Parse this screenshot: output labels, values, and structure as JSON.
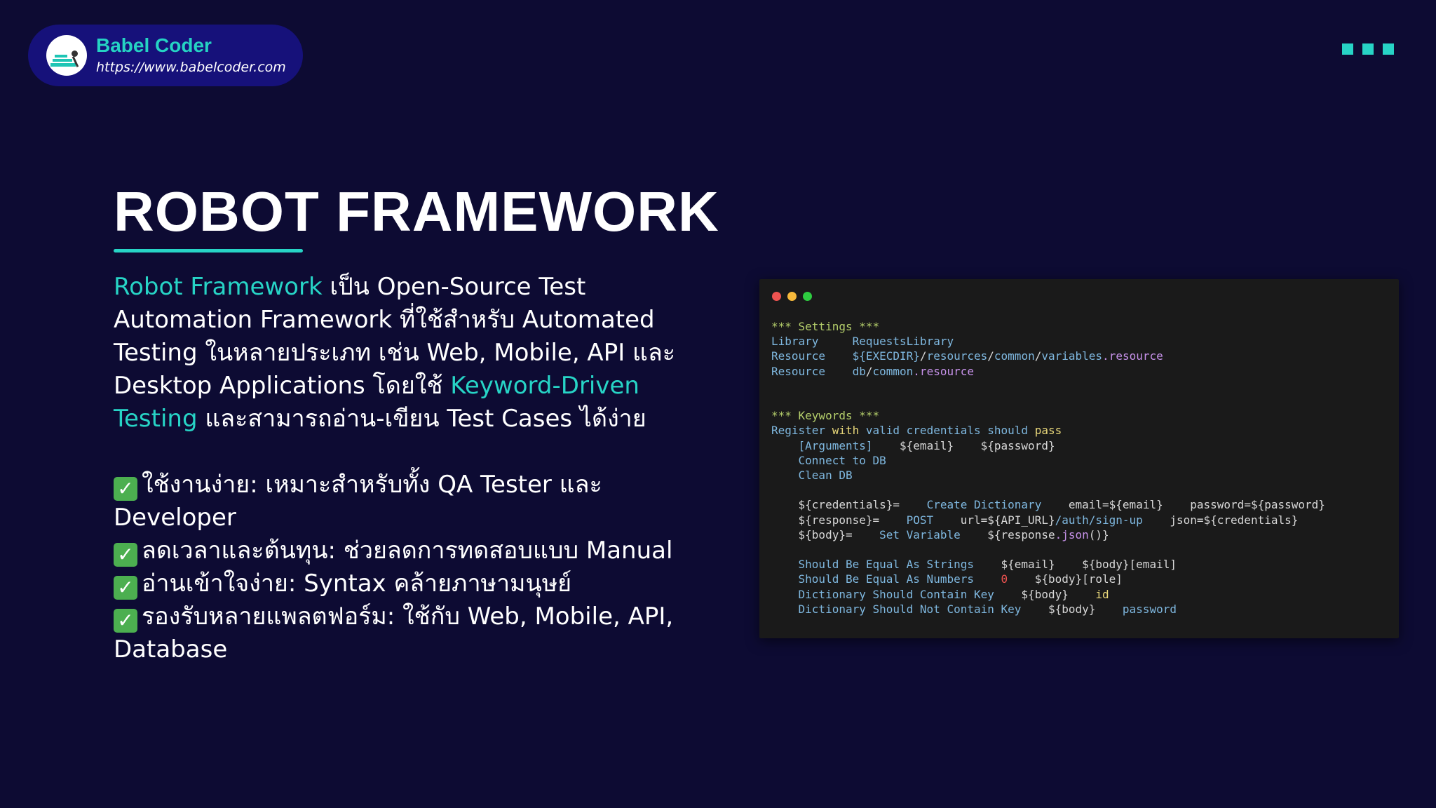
{
  "brand": {
    "name": "Babel Coder",
    "url": "https://www.babelcoder.com",
    "logo_icon": "babel-coder-logo"
  },
  "colors": {
    "background": "#0d0b33",
    "accent": "#27d4c6",
    "brand_pill": "#16117a",
    "code_bg": "#1a1a1a"
  },
  "title": "ROBOT FRAMEWORK",
  "description": {
    "highlight1": "Robot Framework",
    "part1": " เป็น Open-Source Test Automation Framework ที่ใช้สำหรับ Automated Testing ในหลายประเภท เช่น Web, Mobile, API และ Desktop Applications โดยใช้ ",
    "highlight2": "Keyword-Driven Testing",
    "part2": " และสามารถอ่าน-เขียน Test Cases ได้ง่าย"
  },
  "features": [
    {
      "icon": "check-mark-icon",
      "text": "ใช้งานง่าย: เหมาะสำหรับทั้ง QA Tester และ Developer"
    },
    {
      "icon": "check-mark-icon",
      "text": "ลดเวลาและต้นทุน: ช่วยลดการทดสอบแบบ Manual"
    },
    {
      "icon": "check-mark-icon",
      "text": "อ่านเข้าใจง่าย: Syntax คล้ายภาษามนุษย์"
    },
    {
      "icon": "check-mark-icon",
      "text": "รองรับหลายแพลตฟอร์ม: ใช้กับ Web, Mobile, API, Database"
    }
  ],
  "code_window": {
    "window_dots": [
      "#ef5350",
      "#f6b93b",
      "#2ecc40"
    ],
    "lines": [
      [
        [
          "*** Settings ***",
          "green"
        ]
      ],
      [
        [
          "Library",
          "blue"
        ],
        [
          "     RequestsLibrary",
          "blue"
        ]
      ],
      [
        [
          "Resource",
          "blue"
        ],
        [
          "    ${EXECDIR}",
          "blue"
        ],
        [
          "/",
          "white"
        ],
        [
          "resources",
          "blue"
        ],
        [
          "/",
          "white"
        ],
        [
          "common",
          "blue"
        ],
        [
          "/",
          "white"
        ],
        [
          "variables",
          "blue"
        ],
        [
          ".resource",
          "purple"
        ]
      ],
      [
        [
          "Resource",
          "blue"
        ],
        [
          "    db",
          "blue"
        ],
        [
          "/",
          "white"
        ],
        [
          "common",
          "blue"
        ],
        [
          ".resource",
          "purple"
        ]
      ],
      [],
      [],
      [
        [
          "*** Keywords ***",
          "green"
        ]
      ],
      [
        [
          "Register ",
          "blue"
        ],
        [
          "with",
          "yellow"
        ],
        [
          " valid credentials should ",
          "blue"
        ],
        [
          "pass",
          "yellow"
        ]
      ],
      [
        [
          "    [Arguments]",
          "blue"
        ],
        [
          "    ${email}",
          "white"
        ],
        [
          "    ${password}",
          "white"
        ]
      ],
      [
        [
          "    Connect to DB",
          "blue"
        ]
      ],
      [
        [
          "    Clean DB",
          "blue"
        ]
      ],
      [],
      [
        [
          "    ${credentials}=",
          "white"
        ],
        [
          "    Create Dictionary",
          "blue"
        ],
        [
          "    email=${email}",
          "white"
        ],
        [
          "    password=${password}",
          "white"
        ]
      ],
      [
        [
          "    ${response}=",
          "white"
        ],
        [
          "    POST",
          "blue"
        ],
        [
          "    url=${API_URL}",
          "white"
        ],
        [
          "/auth/sign-up",
          "blue"
        ],
        [
          "    json=${credentials}",
          "white"
        ]
      ],
      [
        [
          "    ${body}=",
          "white"
        ],
        [
          "    Set Variable",
          "blue"
        ],
        [
          "    ${response",
          "white"
        ],
        [
          ".json",
          "purple"
        ],
        [
          "()}",
          "white"
        ]
      ],
      [],
      [
        [
          "    Should Be Equal As Strings",
          "blue"
        ],
        [
          "    ${email}",
          "white"
        ],
        [
          "    ${body}[email]",
          "white"
        ]
      ],
      [
        [
          "    Should Be Equal As Numbers",
          "blue"
        ],
        [
          "    0",
          "red"
        ],
        [
          "    ${body}[role]",
          "white"
        ]
      ],
      [
        [
          "    Dictionary Should Contain Key",
          "blue"
        ],
        [
          "    ${body}",
          "white"
        ],
        [
          "    id",
          "yellow"
        ]
      ],
      [
        [
          "    Dictionary Should Not Contain Key",
          "blue"
        ],
        [
          "    ${body}",
          "white"
        ],
        [
          "    password",
          "blue"
        ]
      ]
    ]
  }
}
